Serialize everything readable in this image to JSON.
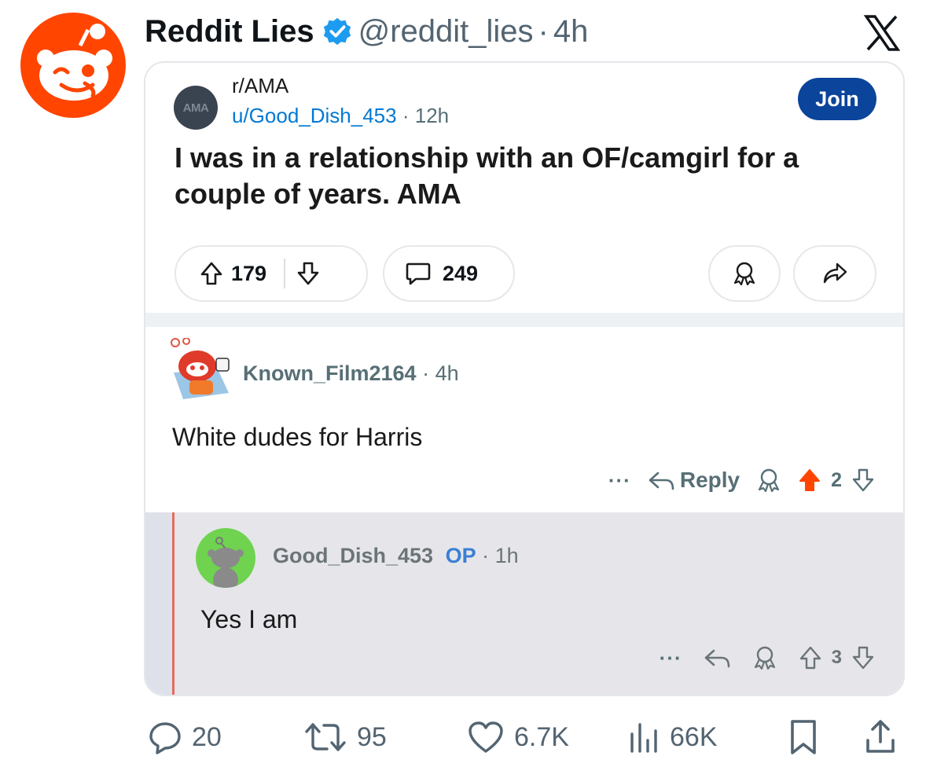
{
  "tweet": {
    "display_name": "Reddit Lies",
    "handle": "@reddit_lies",
    "separator": "·",
    "time": "4h",
    "avatar_icon": "reddit-snoo-wink-icon",
    "verified_icon": "verified-badge-icon",
    "platform_icon": "x-logo-icon"
  },
  "reddit_post": {
    "subreddit_icon_text": "AMA",
    "subreddit": "r/AMA",
    "author": "u/Good_Dish_453",
    "meta_separator": "·",
    "time": "12h",
    "join_label": "Join",
    "title": "I was in a relationship with an OF/camgirl for a couple of years. AMA",
    "upvotes": "179",
    "comments": "249"
  },
  "comment_1": {
    "author": "Known_Film2164",
    "separator": "·",
    "time": "4h",
    "body": "White dudes for Harris",
    "more": "···",
    "reply_label": "Reply",
    "votes": "2",
    "upvoted": true
  },
  "comment_2": {
    "author": "Good_Dish_453",
    "op_badge": "OP",
    "separator": "·",
    "time": "1h",
    "body": "Yes I am",
    "more": "···",
    "votes": "3"
  },
  "tweet_actions": {
    "replies": "20",
    "retweets": "95",
    "likes": "6.7K",
    "views": "66K"
  },
  "colors": {
    "reddit_orange": "#ff4500",
    "join_blue": "#0a449b",
    "link_blue": "#0079d3",
    "x_gray": "#536471",
    "verified_blue": "#1d9bf0",
    "snoo_green": "#6fd34f"
  }
}
